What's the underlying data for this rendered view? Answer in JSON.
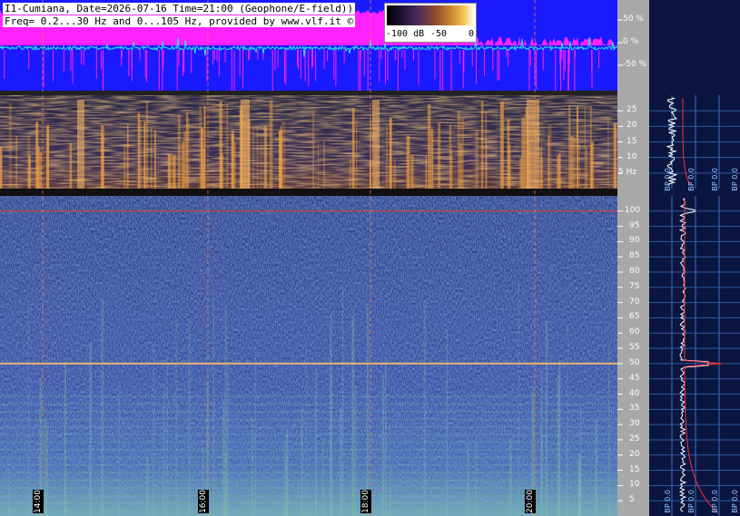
{
  "header": {
    "line1": "I1-Cumiana, Date=2026-07-16 Time=21:00 (Geophone/E-field))",
    "line2": "Freq= 0.2...30 Hz and 0...105 Hz, provided by www.vlf.it ©"
  },
  "colorbar": {
    "ticks": [
      "-100 dB",
      "-50",
      "0"
    ]
  },
  "colors": {
    "waveform_bg": "#1a1aff",
    "amplitude": "#ff22ff",
    "trace": "#33e0e0",
    "spectro_low": "#2c3f8c",
    "spectro_high": "#f0a040",
    "side_panel": "#0a1540",
    "axis_panel": "#a8a8a8"
  },
  "chart_data": [
    {
      "type": "line",
      "name": "waveform-amplitude",
      "ylim": [
        -100,
        100
      ],
      "y_ticks": [
        "50 %",
        "0 %",
        "-50 %"
      ]
    },
    {
      "type": "heatmap",
      "name": "spectrogram-low",
      "ylim": [
        0,
        30
      ],
      "y_ticks": [
        "25",
        "20",
        "15",
        "10",
        "5 Hz"
      ],
      "side_ticks": [
        "BP 0.0",
        "BP 0.0",
        "BP 0.0",
        "BP 0.0",
        "BP 0.0"
      ]
    },
    {
      "type": "heatmap",
      "name": "spectrogram-high",
      "ylim": [
        0,
        105
      ],
      "y_ticks": [
        "100",
        "95",
        "90",
        "85",
        "80",
        "75",
        "70",
        "65",
        "60",
        "55",
        "50",
        "45",
        "40",
        "35",
        "30",
        "25",
        "20",
        "15",
        "10",
        "5"
      ],
      "x_ticks": [
        "14:00",
        "16:00",
        "18:00",
        "20:00"
      ],
      "side_ticks": [
        "BP 0.0",
        "BP 0.0",
        "BP 0.0",
        "BP 0.0",
        "BP 0.0"
      ],
      "lines_hz": [
        100,
        50
      ]
    }
  ]
}
